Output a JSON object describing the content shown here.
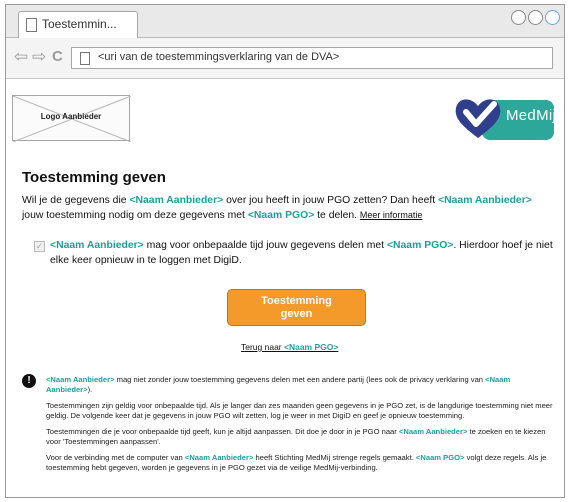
{
  "browser": {
    "tab_title": "Toestemmin...",
    "url": "<uri van de toestemmingsverklaring van de DVA>",
    "nav": {
      "back_glyph": "⇦",
      "forward_glyph": "⇨",
      "reload_glyph": "C"
    }
  },
  "header": {
    "provider_logo_label": "Logo Aanbieder",
    "medmij_logo_text": "MedMij",
    "medmij_color": "#2ea79b",
    "medmij_heart_color": "#2f3f8c"
  },
  "main": {
    "title": "Toestemming geven",
    "intro": {
      "p1": "Wil je de gegevens die ",
      "provider": "<Naam Aanbieder>",
      "p2": " over jou heeft in jouw PGO zetten? Dan heeft ",
      "provider2": "<Naam Aanbieder>",
      "p3": " jouw toestemming nodig om deze gegevens met ",
      "pgo": "<Naam PGO>",
      "p4": " te delen. ",
      "more_info": "Meer informatie"
    },
    "consent": {
      "provider": "<Naam Aanbieder>",
      "p1": " mag voor onbepaalde tijd jouw gegevens delen met ",
      "pgo": "<Naam PGO>",
      "p2": ". Hierdoor hoef je niet elke keer opnieuw in te loggen met DigiD."
    },
    "cta_label_line1": "Toestemming",
    "cta_label_line2": "geven",
    "back_prefix": "Terug naar ",
    "back_pgo": "<Naam PGO>"
  },
  "info": {
    "icon_glyph": "!",
    "block1": {
      "provider": "<Naam Aanbieder>",
      "p1": " mag niet zonder jouw toestemming gegevens delen met een andere partij (lees ook de privacy verklaring van ",
      "provider2": "<Naam Aanbieder>",
      "p2": ")."
    },
    "block2": "Toestemmingen zijn geldig voor onbepaalde tijd. Als je langer dan zes maanden geen gegevens in je PGO zet, is de langdurige toestemming niet meer geldig. De volgende keer dat je gegevens in jouw PGO wilt zetten, log je weer in met DigiD en geef je opnieuw toestemming.",
    "block3": {
      "p1": "Toestemmingen die je voor onbepaalde tijd geeft, kun je altijd aanpassen. Dit doe je door in je PGO naar ",
      "provider": "<Naam Aanbieder>",
      "p2": " te zoeken en te kiezen voor 'Toestemmingen aanpassen'."
    },
    "block4": {
      "p1": "Voor de verbinding met de computer van ",
      "provider": "<Naam Aanbieder>",
      "p2": " heeft Stichting MedMij strenge regels gemaakt. ",
      "pgo": "<Naam PGO>",
      "p3": " volgt deze regels. Als je toestemming hebt gegeven, worden je gegevens in je PGO gezet via de veilige MedMij-verbinding."
    }
  },
  "colors": {
    "placeholder_teal": "#1ba09a",
    "cta_orange": "#f39a2a"
  }
}
